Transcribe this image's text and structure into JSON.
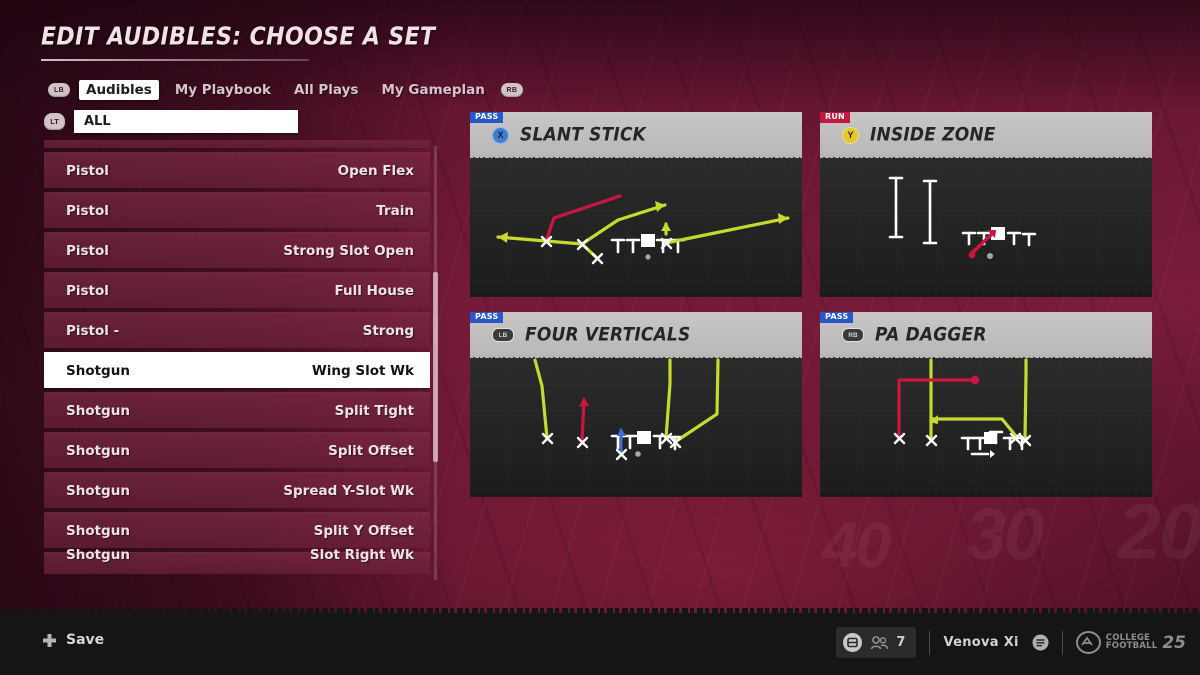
{
  "header": {
    "title": "EDIT AUDIBLES: CHOOSE A SET"
  },
  "tabs": {
    "left_bumper": "LB",
    "right_bumper": "RB",
    "items": [
      {
        "label": "Audibles",
        "active": true
      },
      {
        "label": "My Playbook",
        "active": false
      },
      {
        "label": "All Plays",
        "active": false
      },
      {
        "label": "My Gameplan",
        "active": false
      }
    ]
  },
  "filter": {
    "trigger": "LT",
    "value": "ALL"
  },
  "formation_list": {
    "rows": [
      {
        "formation": "",
        "name": "",
        "state": "clip-top"
      },
      {
        "formation": "Pistol",
        "name": "Open Flex",
        "state": "normal"
      },
      {
        "formation": "Pistol",
        "name": "Train",
        "state": "normal"
      },
      {
        "formation": "Pistol",
        "name": "Strong Slot Open",
        "state": "normal"
      },
      {
        "formation": "Pistol",
        "name": "Full House",
        "state": "normal"
      },
      {
        "formation": "Pistol -",
        "name": "Strong",
        "state": "normal"
      },
      {
        "formation": "Shotgun",
        "name": "Wing Slot Wk",
        "state": "selected"
      },
      {
        "formation": "Shotgun",
        "name": "Split Tight",
        "state": "normal"
      },
      {
        "formation": "Shotgun",
        "name": "Split Offset",
        "state": "normal"
      },
      {
        "formation": "Shotgun",
        "name": "Spread Y-Slot Wk",
        "state": "normal"
      },
      {
        "formation": "Shotgun",
        "name": "Split Y Offset",
        "state": "normal"
      },
      {
        "formation": "Shotgun",
        "name": "Slot Right Wk",
        "state": "clip-bot"
      }
    ]
  },
  "plays": [
    {
      "tag": "PASS",
      "button": "X",
      "button_kind": "x",
      "title": "SLANT STICK"
    },
    {
      "tag": "RUN",
      "button": "Y",
      "button_kind": "y",
      "title": "INSIDE ZONE"
    },
    {
      "tag": "PASS",
      "button": "LB",
      "button_kind": "bumper",
      "title": "FOUR VERTICALS"
    },
    {
      "tag": "PASS",
      "button": "RB",
      "button_kind": "bumper",
      "title": "PA DAGGER"
    }
  ],
  "footer": {
    "save_label": "Save",
    "party_count": "7",
    "gamertag": "Venova Xi",
    "brand_line1": "COLLEGE",
    "brand_line2": "FOOTBALL",
    "brand_year": "25"
  },
  "field_numerals": [
    "40",
    "30",
    "20"
  ],
  "colors": {
    "route_primary": "#c6d92e",
    "route_red": "#cf1441",
    "route_blue": "#3a6fd8",
    "pass_badge": "#2757c8",
    "run_badge": "#c4193f",
    "selection": "#ffffff",
    "background": "#6b1734"
  }
}
